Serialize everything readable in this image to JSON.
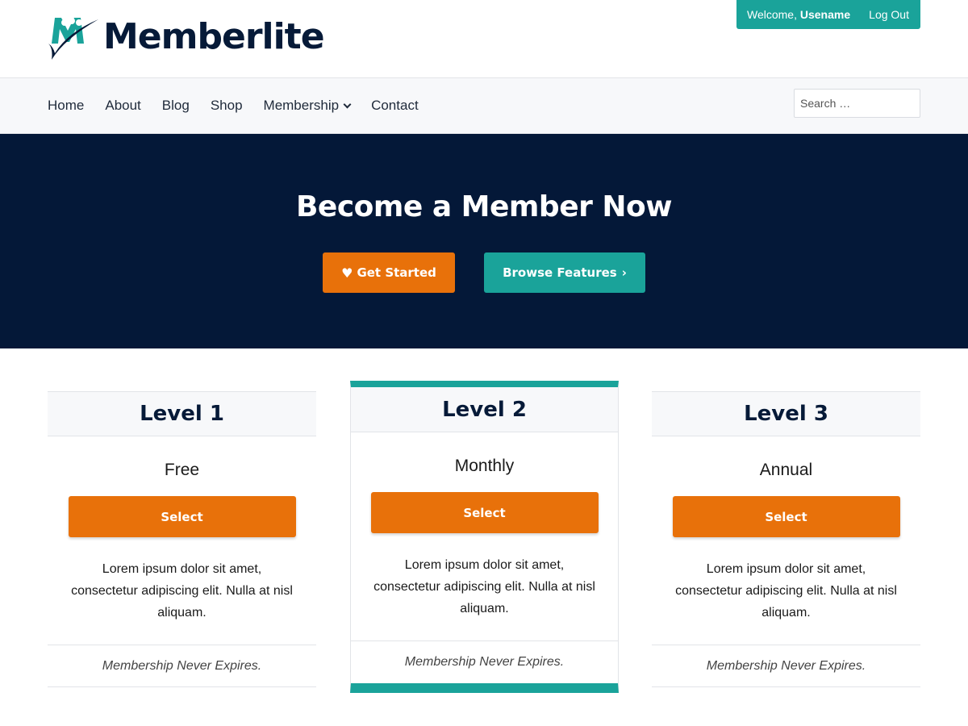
{
  "site": {
    "title": "Memberlite"
  },
  "member_bar": {
    "welcome_prefix": "Welcome, ",
    "username": "Usename",
    "logout_label": "Log Out"
  },
  "nav": {
    "items": [
      {
        "label": "Home"
      },
      {
        "label": "About"
      },
      {
        "label": "Blog"
      },
      {
        "label": "Shop"
      },
      {
        "label": "Membership",
        "has_submenu": true
      },
      {
        "label": "Contact"
      }
    ],
    "search_placeholder": "Search …"
  },
  "hero": {
    "title": "Become a Member Now",
    "primary_button": "Get Started",
    "secondary_button": "Browse Features",
    "primary_icon": "heart-icon",
    "secondary_icon": "chevron-right-icon"
  },
  "levels": [
    {
      "name": "Level 1",
      "price": "Free",
      "button": "Select",
      "description": "Lorem ipsum dolor sit amet, consectetur adipiscing elit. Nulla at nisl aliquam.",
      "expiration": "Membership Never Expires.",
      "featured": false
    },
    {
      "name": "Level 2",
      "price": "Monthly",
      "button": "Select",
      "description": "Lorem ipsum dolor sit amet, consectetur adipiscing elit. Nulla at nisl aliquam.",
      "expiration": "Membership Never Expires.",
      "featured": true
    },
    {
      "name": "Level 3",
      "price": "Annual",
      "button": "Select",
      "description": "Lorem ipsum dolor sit amet, consectetur adipiscing elit. Nulla at nisl aliquam.",
      "expiration": "Membership Never Expires.",
      "featured": false
    }
  ],
  "colors": {
    "navy": "#041838",
    "teal": "#1aa39a",
    "orange": "#e8710a",
    "light_gray": "#f7f8fa"
  }
}
